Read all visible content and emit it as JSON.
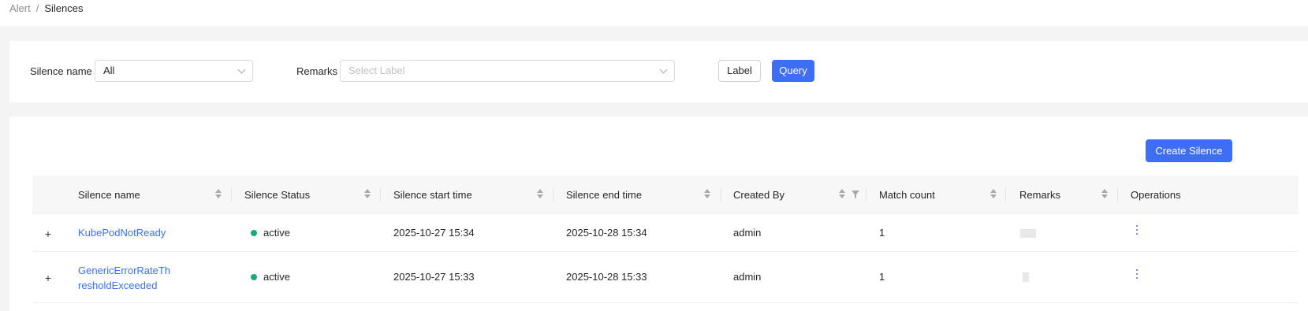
{
  "breadcrumb": {
    "parent": "Alert",
    "separator": "/",
    "current": "Silences"
  },
  "filters": {
    "silence_name_label": "Silence name",
    "silence_name_value": "All",
    "remarks_label": "Remarks",
    "remarks_placeholder": "Select Label",
    "label_button": "Label",
    "query_button": "Query"
  },
  "actions": {
    "create_button": "Create Silence"
  },
  "table": {
    "columns": [
      {
        "label": "Silence name",
        "sortable": true
      },
      {
        "label": "Silence Status",
        "sortable": true
      },
      {
        "label": "Silence start time",
        "sortable": true
      },
      {
        "label": "Silence end time",
        "sortable": true
      },
      {
        "label": "Created By",
        "sortable": true,
        "filterable": true
      },
      {
        "label": "Match count",
        "sortable": true
      },
      {
        "label": "Remarks",
        "sortable": true
      },
      {
        "label": "Operations",
        "sortable": false
      }
    ],
    "rows": [
      {
        "name_line1": "KubePodNotReady",
        "name_line2": "",
        "status": "active",
        "start": "2025-10-27 15:34",
        "end": "2025-10-28 15:34",
        "created_by": "admin",
        "match_count": "1"
      },
      {
        "name_line1": "GenericErrorRateTh",
        "name_line2": "resholdExceeded",
        "status": "active",
        "start": "2025-10-27 15:33",
        "end": "2025-10-28 15:33",
        "created_by": "admin",
        "match_count": "1"
      }
    ]
  },
  "colors": {
    "primary": "#3d6ef5",
    "status_active": "#19a974"
  },
  "icons": {
    "expand": "plus-icon",
    "sort": "sort-icon",
    "filter": "filter-icon",
    "more": "more-vertical-icon",
    "chevron": "chevron-down-icon"
  }
}
